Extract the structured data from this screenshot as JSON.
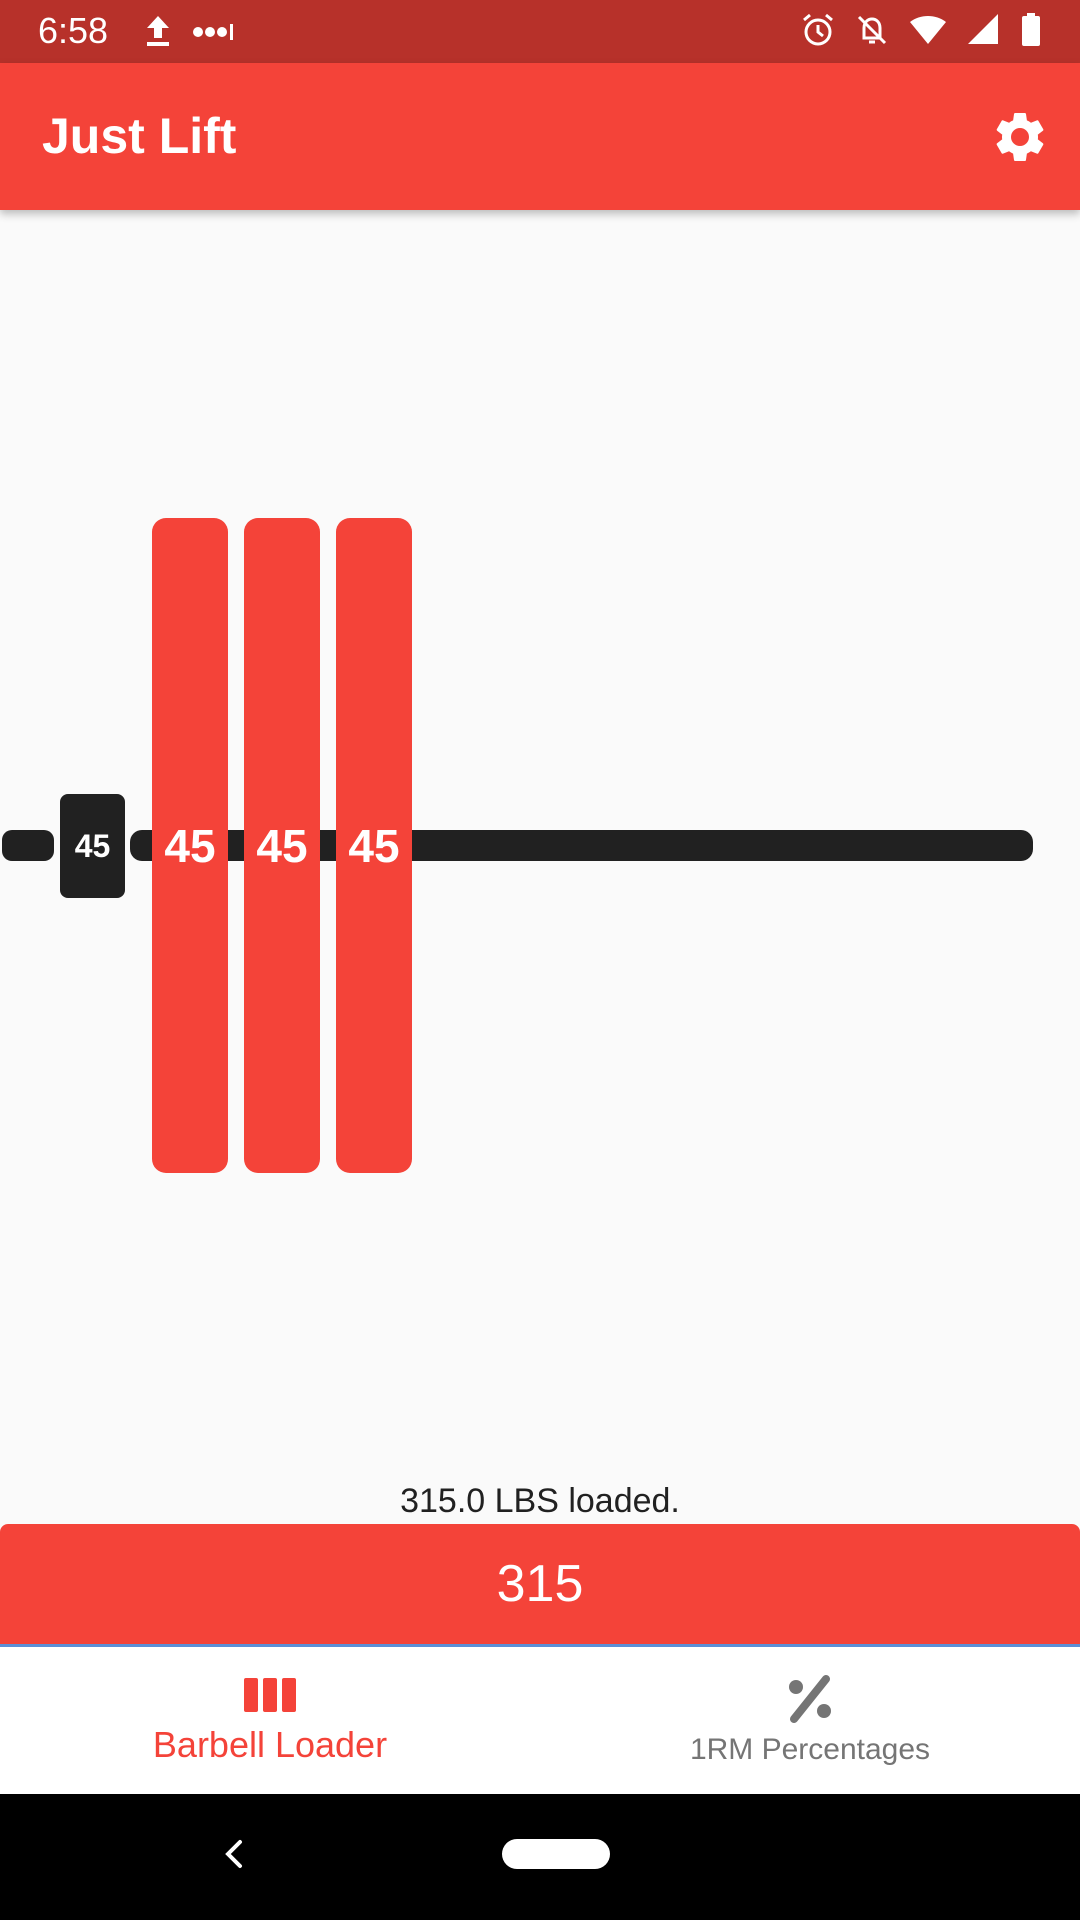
{
  "status_bar": {
    "time": "6:58",
    "icons_left": [
      "upload-icon",
      "more-dots-icon"
    ],
    "icons_right": [
      "alarm-icon",
      "notifications-off-icon",
      "wifi-icon",
      "signal-icon",
      "battery-icon"
    ]
  },
  "app_bar": {
    "title": "Just Lift",
    "settings_icon": "gear-icon",
    "color": "#f44339"
  },
  "barbell": {
    "collar_label": "45",
    "plates": [
      {
        "label": "45"
      },
      {
        "label": "45"
      },
      {
        "label": "45"
      }
    ],
    "plate_color": "#f44339",
    "bar_color": "#212121"
  },
  "loaded_text": "315.0 LBS loaded.",
  "weight_input": {
    "value": "315"
  },
  "bottom_nav": {
    "items": [
      {
        "label": "Barbell Loader",
        "icon": "barbell-plates-icon",
        "active": true
      },
      {
        "label": "1RM Percentages",
        "icon": "percent-icon",
        "active": false
      }
    ],
    "active_color": "#f44339",
    "inactive_color": "#757575"
  },
  "system_nav": {
    "icons": [
      "back-icon",
      "home-pill"
    ]
  }
}
